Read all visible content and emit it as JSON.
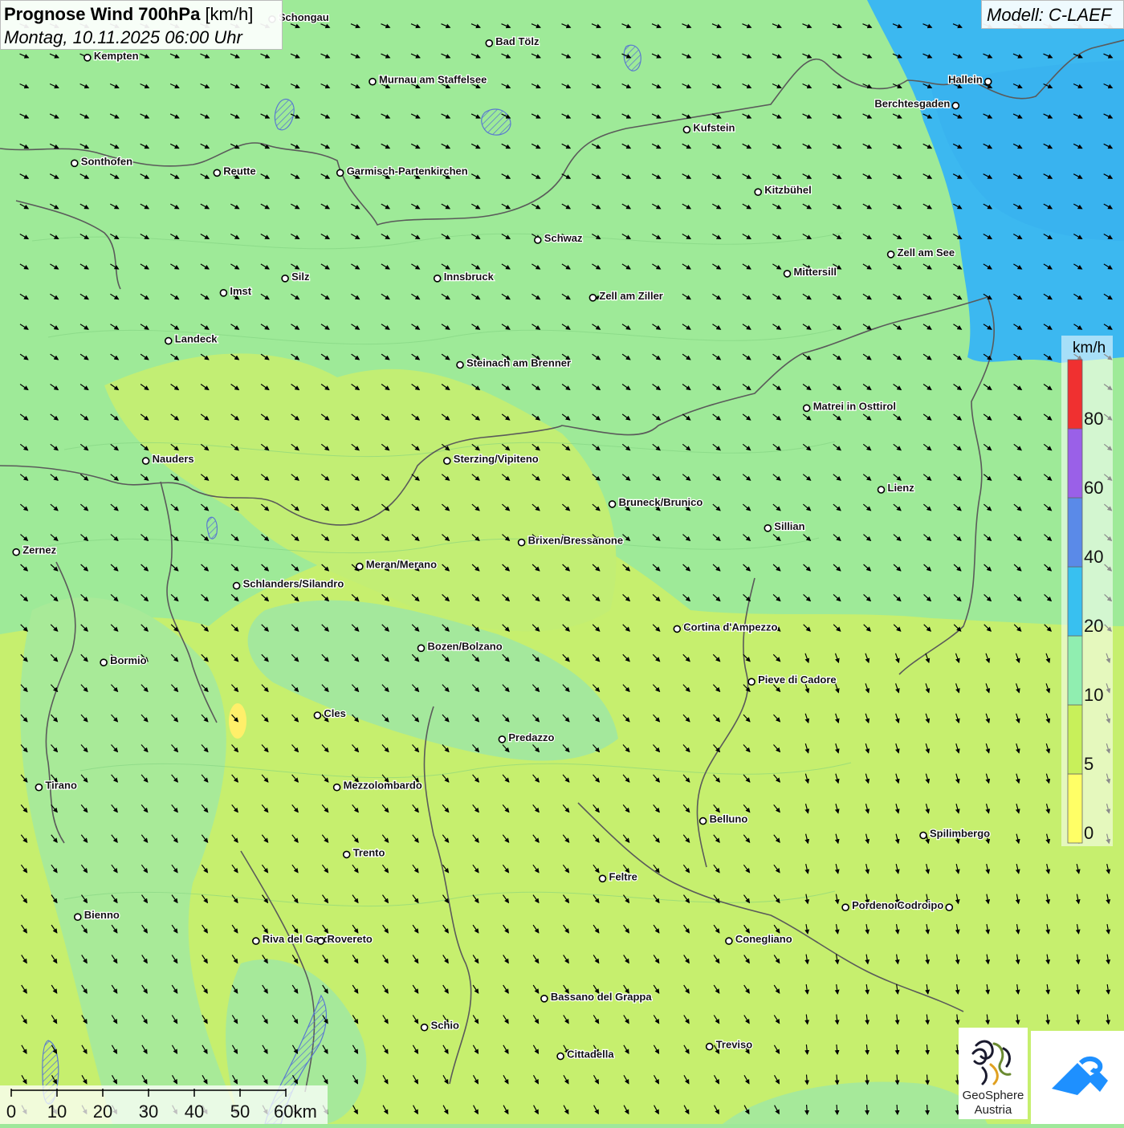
{
  "title": {
    "main": "Prognose Wind 700hPa",
    "unit": "[km/h]",
    "date": "Montag, 10.11.2025 06:00 Uhr"
  },
  "model_label": "Modell: C-LAEF",
  "legend": {
    "unit": "km/h",
    "bands": [
      {
        "from": 0,
        "to": 5,
        "color": "#ffff66"
      },
      {
        "from": 5,
        "to": 10,
        "color": "#c8f05a"
      },
      {
        "from": 10,
        "to": 20,
        "color": "#90eeb0"
      },
      {
        "from": 20,
        "to": 40,
        "color": "#38c0f0"
      },
      {
        "from": 40,
        "to": 60,
        "color": "#5a8ae8"
      },
      {
        "from": 60,
        "to": 80,
        "color": "#9a60e8"
      },
      {
        "from": 80,
        "to": 100,
        "color": "#f03030"
      }
    ],
    "tick_labels": [
      "0",
      "5",
      "10",
      "20",
      "40",
      "60",
      "80"
    ]
  },
  "scale_bar": {
    "labels": [
      "0",
      "10",
      "20",
      "30",
      "40",
      "50",
      "60km"
    ]
  },
  "logos": {
    "geosphere_line1": "GeoSphere",
    "geosphere_line2": "Austria"
  },
  "cities": [
    {
      "name": "Schongau",
      "lon": 10.89,
      "lat": 47.81
    },
    {
      "name": "Bad Tölz",
      "lon": 11.56,
      "lat": 47.76
    },
    {
      "name": "Kempten",
      "lon": 10.32,
      "lat": 47.73
    },
    {
      "name": "Murnau am Staffelsee",
      "lon": 11.2,
      "lat": 47.68
    },
    {
      "name": "Hallein",
      "lon": 13.1,
      "lat": 47.68
    },
    {
      "name": "Berchtesgaden",
      "lon": 13.0,
      "lat": 47.63
    },
    {
      "name": "Kufstein",
      "lon": 12.17,
      "lat": 47.58
    },
    {
      "name": "Sonthofen",
      "lon": 10.28,
      "lat": 47.51
    },
    {
      "name": "Reutte",
      "lon": 10.72,
      "lat": 47.49
    },
    {
      "name": "Garmisch-Partenkirchen",
      "lon": 11.1,
      "lat": 47.49
    },
    {
      "name": "Kitzbühel",
      "lon": 12.39,
      "lat": 47.45
    },
    {
      "name": "Schwaz",
      "lon": 11.71,
      "lat": 47.35
    },
    {
      "name": "Zell am See",
      "lon": 12.8,
      "lat": 47.32
    },
    {
      "name": "Mittersill",
      "lon": 12.48,
      "lat": 47.28
    },
    {
      "name": "Innsbruck",
      "lon": 11.4,
      "lat": 47.27
    },
    {
      "name": "Silz",
      "lon": 10.93,
      "lat": 47.27
    },
    {
      "name": "Imst",
      "lon": 10.74,
      "lat": 47.24
    },
    {
      "name": "Zell am Ziller",
      "lon": 11.88,
      "lat": 47.23
    },
    {
      "name": "Landeck",
      "lon": 10.57,
      "lat": 47.14
    },
    {
      "name": "Steinach am Brenner",
      "lon": 11.47,
      "lat": 47.09
    },
    {
      "name": "Matrei in Osttirol",
      "lon": 12.54,
      "lat": 47.0
    },
    {
      "name": "Nauders",
      "lon": 10.5,
      "lat": 46.89
    },
    {
      "name": "Sterzing/Vipiteno",
      "lon": 11.43,
      "lat": 46.89
    },
    {
      "name": "Lienz",
      "lon": 12.77,
      "lat": 46.83
    },
    {
      "name": "Bruneck/Brunico",
      "lon": 11.94,
      "lat": 46.8
    },
    {
      "name": "Sillian",
      "lon": 12.42,
      "lat": 46.75
    },
    {
      "name": "Brixen/Bressanone",
      "lon": 11.66,
      "lat": 46.72
    },
    {
      "name": "Zernez",
      "lon": 10.1,
      "lat": 46.7
    },
    {
      "name": "Meran/Merano",
      "lon": 11.16,
      "lat": 46.67
    },
    {
      "name": "Schlanders/Silandro",
      "lon": 10.78,
      "lat": 46.63
    },
    {
      "name": "Cortina d'Ampezzo",
      "lon": 12.14,
      "lat": 46.54
    },
    {
      "name": "Bozen/Bolzano",
      "lon": 11.35,
      "lat": 46.5
    },
    {
      "name": "Bormio",
      "lon": 10.37,
      "lat": 46.47
    },
    {
      "name": "Pieve di Cadore",
      "lon": 12.37,
      "lat": 46.43
    },
    {
      "name": "Cles",
      "lon": 11.03,
      "lat": 46.36
    },
    {
      "name": "Predazzo",
      "lon": 11.6,
      "lat": 46.31
    },
    {
      "name": "Tirano",
      "lon": 10.17,
      "lat": 46.21
    },
    {
      "name": "Mezzolombardo",
      "lon": 11.09,
      "lat": 46.21
    },
    {
      "name": "Belluno",
      "lon": 12.22,
      "lat": 46.14
    },
    {
      "name": "Spilimbergo",
      "lon": 12.9,
      "lat": 46.11
    },
    {
      "name": "Trento",
      "lon": 11.12,
      "lat": 46.07
    },
    {
      "name": "Feltre",
      "lon": 11.91,
      "lat": 46.02
    },
    {
      "name": "Pordenone",
      "lon": 12.66,
      "lat": 45.96
    },
    {
      "name": "Codroipo",
      "lon": 12.98,
      "lat": 45.96
    },
    {
      "name": "Bienno",
      "lon": 10.29,
      "lat": 45.94
    },
    {
      "name": "Riva del Garda",
      "lon": 10.84,
      "lat": 45.89
    },
    {
      "name": "Rovereto",
      "lon": 11.04,
      "lat": 45.89
    },
    {
      "name": "Conegliano",
      "lon": 12.3,
      "lat": 45.89
    },
    {
      "name": "Bassano del Grappa",
      "lon": 11.73,
      "lat": 45.77
    },
    {
      "name": "Schio",
      "lon": 11.36,
      "lat": 45.71
    },
    {
      "name": "Treviso",
      "lon": 12.24,
      "lat": 45.67
    },
    {
      "name": "Cittadella",
      "lon": 11.78,
      "lat": 45.65
    }
  ]
}
